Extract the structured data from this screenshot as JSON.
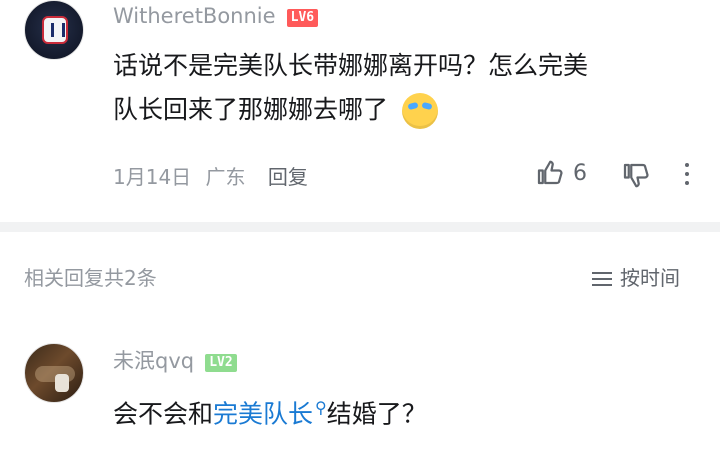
{
  "comment": {
    "username": "WitheretBonnie",
    "level": "LV6",
    "content_line1": "话说不是完美队长带娜娜离开吗？怎么完美",
    "content_line2": "队长回来了那娜娜去哪了",
    "emoji": "laughing-crying-emoji",
    "date": "1月14日",
    "location": "广东",
    "reply_label": "回复",
    "like_count": "6"
  },
  "replies_section": {
    "title": "相关回复共2条",
    "sort_label": "按时间"
  },
  "reply": {
    "username": "未泯qvq",
    "level": "LV2",
    "text_before": "会不会和",
    "link_text": "完美队长",
    "text_after": "结婚了？"
  },
  "colors": {
    "level6": "#ff5a5a",
    "level2": "#8fdc8f",
    "link": "#1a7ad3",
    "divider": "#f1f2f3"
  }
}
